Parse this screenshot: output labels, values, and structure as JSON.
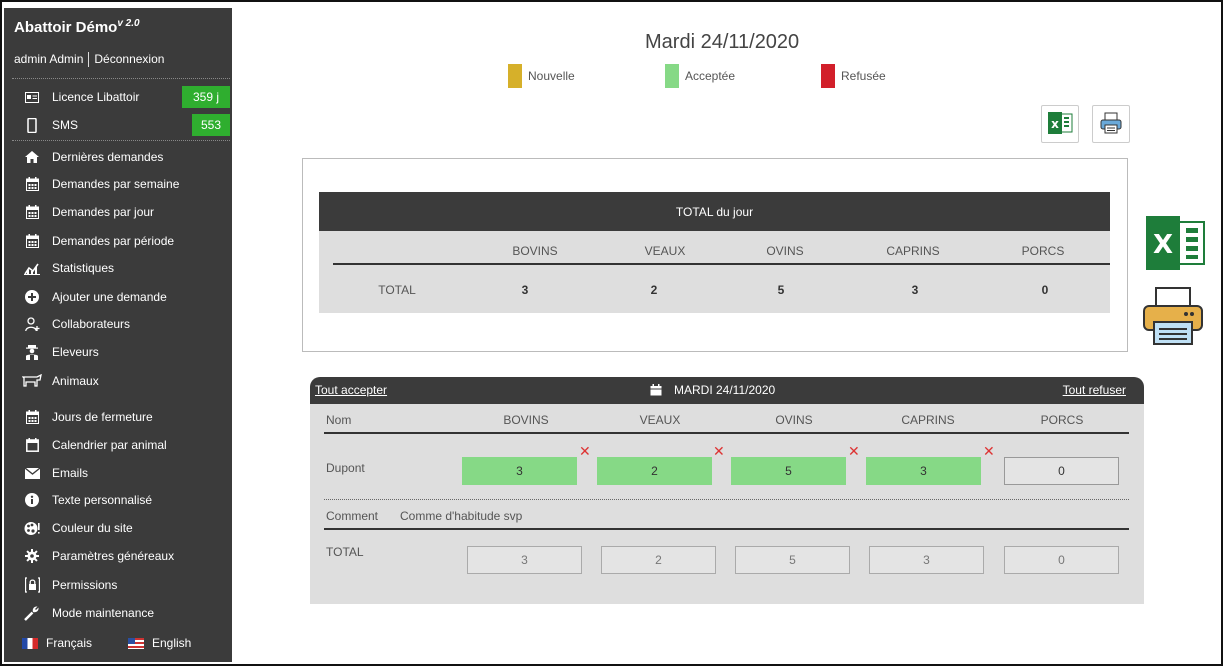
{
  "app": {
    "name": "Abattoir Démo",
    "version": "v 2.0"
  },
  "user": {
    "name": "admin Admin",
    "logout": "Déconnexion"
  },
  "sidebar": {
    "licence": {
      "label": "Licence Libattoir",
      "badge": "359 j",
      "icon": "id-card-icon"
    },
    "sms": {
      "label": "SMS",
      "badge": "553",
      "icon": "mobile-icon"
    },
    "items": [
      {
        "label": "Dernières demandes",
        "icon": "home-icon"
      },
      {
        "label": "Demandes par semaine",
        "icon": "calendar-icon"
      },
      {
        "label": "Demandes par jour",
        "icon": "calendar-icon"
      },
      {
        "label": "Demandes par période",
        "icon": "calendar-icon"
      },
      {
        "label": "Statistiques",
        "icon": "chart-icon"
      },
      {
        "label": "Ajouter une demande",
        "icon": "plus-circle-icon"
      },
      {
        "label": "Collaborateurs",
        "icon": "user-add-icon"
      },
      {
        "label": "Eleveurs",
        "icon": "farmer-icon"
      },
      {
        "label": "Animaux",
        "icon": "cow-icon"
      },
      {
        "label": "Jours de fermeture",
        "icon": "calendar-icon"
      },
      {
        "label": "Calendrier par animal",
        "icon": "calendar-blank-icon"
      },
      {
        "label": "Emails",
        "icon": "envelope-icon"
      },
      {
        "label": "Texte personnalisé",
        "icon": "info-icon"
      },
      {
        "label": "Couleur du site",
        "icon": "palette-icon"
      },
      {
        "label": "Paramètres généreaux",
        "icon": "gear-icon"
      },
      {
        "label": "Permissions",
        "icon": "lock-icon"
      },
      {
        "label": "Mode maintenance",
        "icon": "wrench-icon"
      }
    ],
    "languages": [
      "Français",
      "English"
    ]
  },
  "main": {
    "date_title": "Mardi 24/11/2020",
    "legend": [
      {
        "label": "Nouvelle",
        "color": "#d6b02a"
      },
      {
        "label": "Acceptée",
        "color": "#86d986"
      },
      {
        "label": "Refusée",
        "color": "#d21f2a"
      }
    ],
    "total_box": {
      "title": "TOTAL du jour",
      "columns": [
        "BOVINS",
        "VEAUX",
        "OVINS",
        "CAPRINS",
        "PORCS"
      ],
      "row_label": "TOTAL",
      "values": [
        "3",
        "2",
        "5",
        "3",
        "0"
      ]
    },
    "day_panel": {
      "accept_all": "Tout accepter",
      "refuse_all": "Tout refuser",
      "date": "MARDI 24/11/2020",
      "name_header": "Nom",
      "columns": [
        "BOVINS",
        "VEAUX",
        "OVINS",
        "CAPRINS",
        "PORCS"
      ],
      "row": {
        "name": "Dupont",
        "values": [
          "3",
          "2",
          "5",
          "3",
          "0"
        ]
      },
      "comment_label": "Comment",
      "comment_text": "Comme d'habitude svp",
      "total_label": "TOTAL",
      "totals": [
        "3",
        "2",
        "5",
        "3",
        "0"
      ]
    }
  },
  "colors": {
    "sidebar_bg": "#3b3b3b",
    "badge_green": "#2fae2f",
    "accepted": "#86d986"
  }
}
